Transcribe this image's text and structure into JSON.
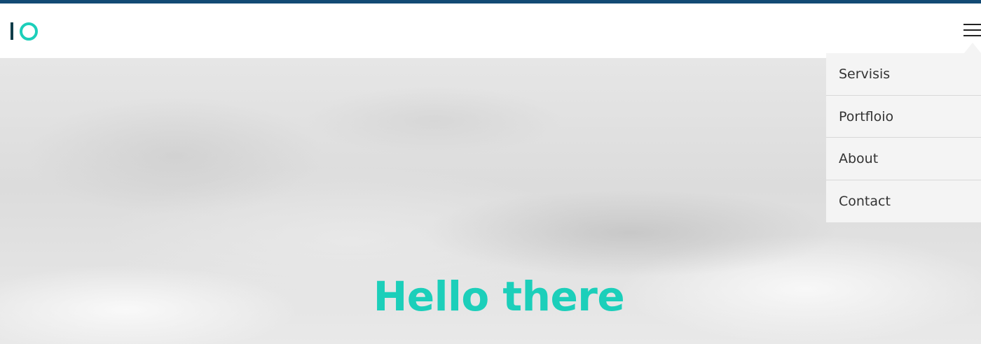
{
  "header": {
    "logo_name": "logo-io",
    "menu_icon": "hamburger-menu-icon"
  },
  "menu": {
    "items": [
      {
        "label": "Servisis"
      },
      {
        "label": "Portfloio"
      },
      {
        "label": "About"
      },
      {
        "label": "Contact"
      }
    ]
  },
  "hero": {
    "title": "Hello there"
  },
  "colors": {
    "accent": "#1ccfba",
    "topbar": "#124a74",
    "logo_dark": "#0f3d4a",
    "menu_bg": "#f4f4f4"
  }
}
